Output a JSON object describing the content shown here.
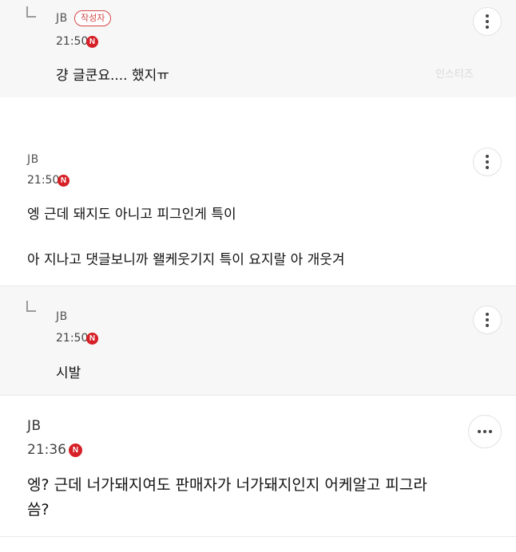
{
  "comments": [
    {
      "author": "JB",
      "author_badge": "작성자",
      "time": "21:50",
      "new_badge": "N",
      "lines": [
        "걍 글쿤요.... 했지ㅠ"
      ]
    },
    {
      "author": "JB",
      "time": "21:50",
      "new_badge": "N",
      "lines": [
        "엥 근데 돼지도 아니고 피그인게 특이",
        "아 지나고 댓글보니까 왤케웃기지 특이 요지랄 아 개웃겨"
      ]
    },
    {
      "author": "JB",
      "time": "21:50",
      "new_badge": "N",
      "lines": [
        "시발"
      ]
    },
    {
      "author": "JB",
      "time": "21:36",
      "new_badge": "N",
      "lines": [
        "엥? 근데 너가돼지여도 판매자가 너가돼지인지 어케알고 피그라",
        "씀?"
      ]
    }
  ],
  "watermark": "인스티즈",
  "icons": {
    "more": "more-vertical-icon",
    "more_horizontal": "more-horizontal-icon",
    "reply": "reply-arrow-icon"
  }
}
